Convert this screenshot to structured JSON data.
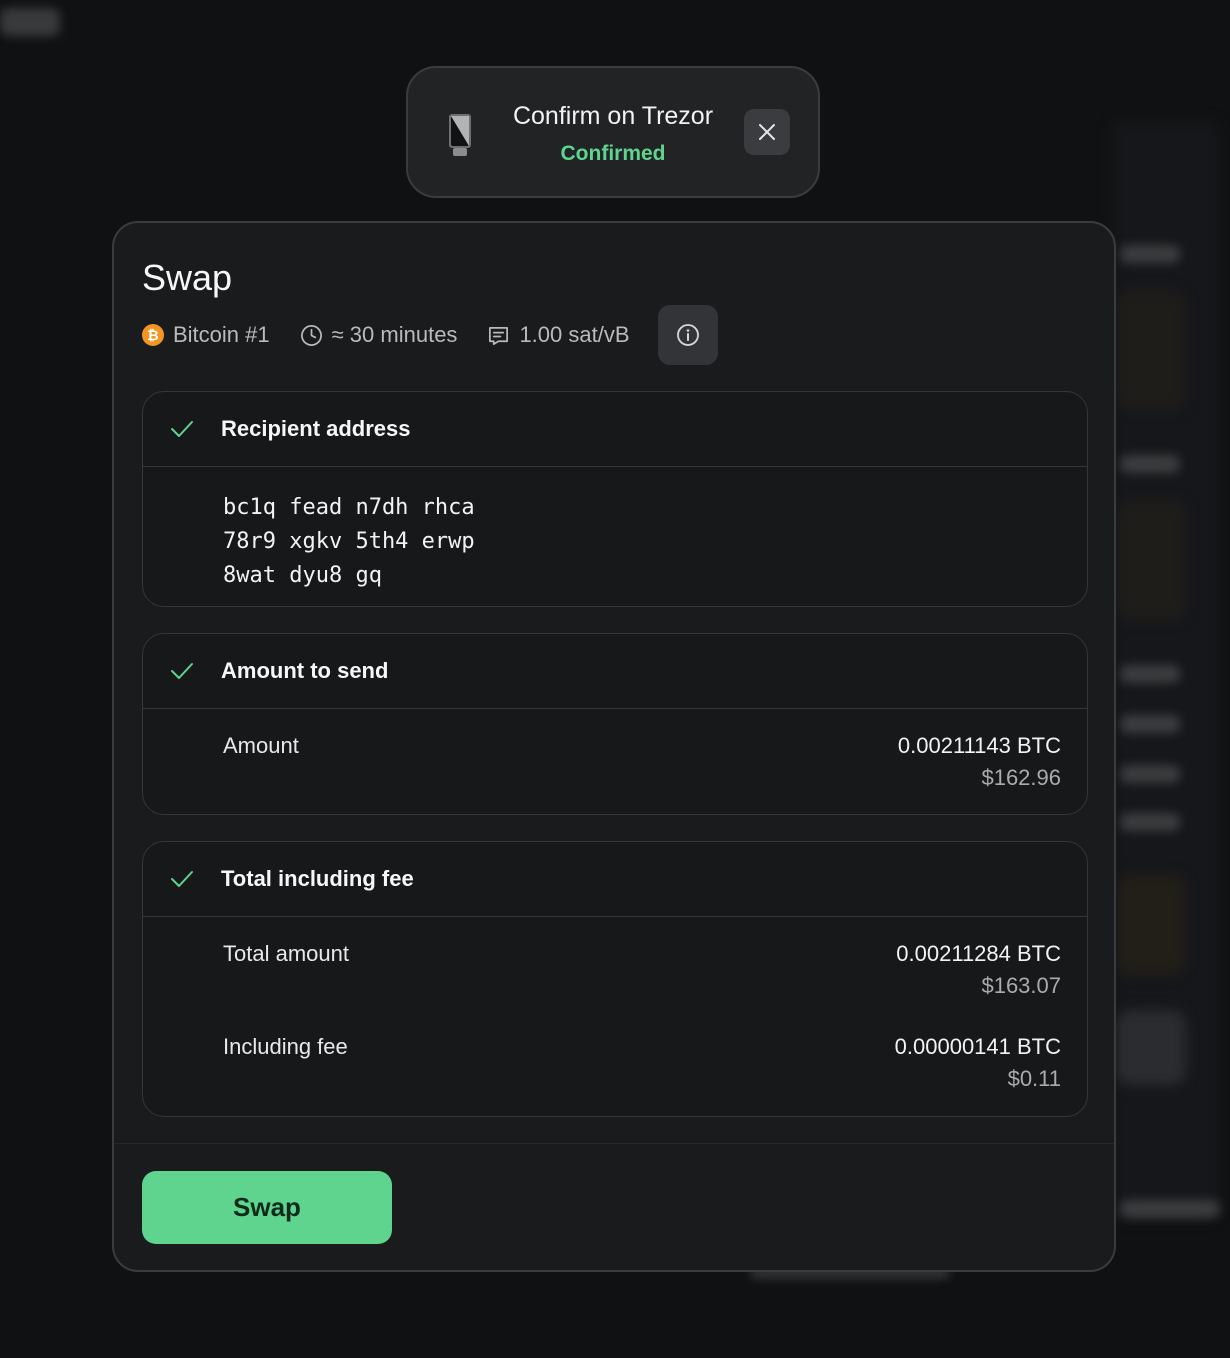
{
  "toast": {
    "title": "Confirm on Trezor",
    "status": "Confirmed"
  },
  "modal": {
    "title": "Swap",
    "meta": {
      "account": "Bitcoin #1",
      "time": "≈ 30 minutes",
      "fee_rate": "1.00 sat/vB"
    },
    "recipient": {
      "label": "Recipient address",
      "address_lines": [
        "bc1q fead n7dh rhca",
        "78r9 xgkv 5th4 erwp",
        "8wat dyu8 gq"
      ]
    },
    "amount": {
      "label": "Amount to send",
      "row_label": "Amount",
      "crypto": "0.00211143 BTC",
      "fiat": "$162.96"
    },
    "total": {
      "label": "Total including fee",
      "total_label": "Total amount",
      "total_crypto": "0.00211284 BTC",
      "total_fiat": "$163.07",
      "fee_label": "Including fee",
      "fee_crypto": "0.00000141 BTC",
      "fee_fiat": "$0.11"
    },
    "swap_button": "Swap"
  },
  "colors": {
    "accent_green": "#5fd48e",
    "bitcoin_orange": "#f29523"
  }
}
